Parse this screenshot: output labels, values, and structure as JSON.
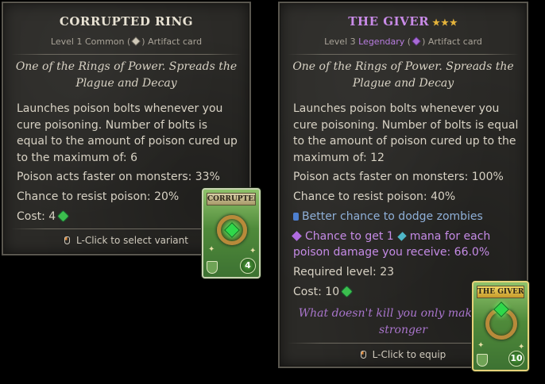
{
  "left_tooltip": {
    "title": "CORRUPTED RING",
    "subtitle_level": "Level 1",
    "subtitle_rarity": "Common",
    "subtitle_type": "Artifact card",
    "flavor": "One of the Rings of Power. Spreads the Plague and Decay",
    "effect": "Launches poison bolts whenever you cure poisoning. Number of bolts is equal to the amount of poison cured up to the maximum of: 6",
    "poison_faster": "Poison acts faster on monsters: 33%",
    "resist_poison": "Chance to resist poison: 20%",
    "cost_label": "Cost: 4",
    "hint": "L-Click to select variant",
    "icons": [
      "common-rarity-gem-icon",
      "mana-gem-icon",
      "mouse-left-click-icon"
    ]
  },
  "right_tooltip": {
    "title": "THE GIVER",
    "stars": "★★★",
    "subtitle_level": "Level 3",
    "subtitle_rarity": "Legendary",
    "subtitle_type": "Artifact card",
    "flavor": "One of the Rings of Power. Spreads the Plague and Decay",
    "effect": "Launches poison bolts whenever you cure poisoning. Number of bolts is equal to the amount of poison cured up to the maximum of: 12",
    "poison_faster": "Poison acts faster on monsters: 100%",
    "resist_poison": "Chance to resist poison: 40%",
    "bonus_dodge": "Better chance to dodge zombies",
    "bonus_mana_a": "Chance to get 1",
    "bonus_mana_b": "mana for each",
    "bonus_mana_c": "poison damage you receive: 66.0%",
    "required_level": "Required level: 23",
    "cost_label": "Cost: 10",
    "quote": "What doesn't kill you only makes you stronger",
    "hint": "L-Click to equip",
    "icons": [
      "legendary-rarity-gem-icon",
      "blue-shard-icon",
      "purple-gem-icon",
      "cyan-mana-icon",
      "mana-gem-icon",
      "mouse-left-click-icon"
    ]
  },
  "cards": {
    "left": {
      "banner": "CORRUPTED RING",
      "cost": "4"
    },
    "right": {
      "banner": "THE GIVER",
      "cost": "10"
    }
  },
  "colors": {
    "panel_bg": "#2b2a27",
    "legendary": "#c98be8",
    "quote": "#a975cc",
    "bonus_blue": "#8fb0d8",
    "mana_green": "#3cbf4e",
    "star_gold": "#e4b33b"
  }
}
